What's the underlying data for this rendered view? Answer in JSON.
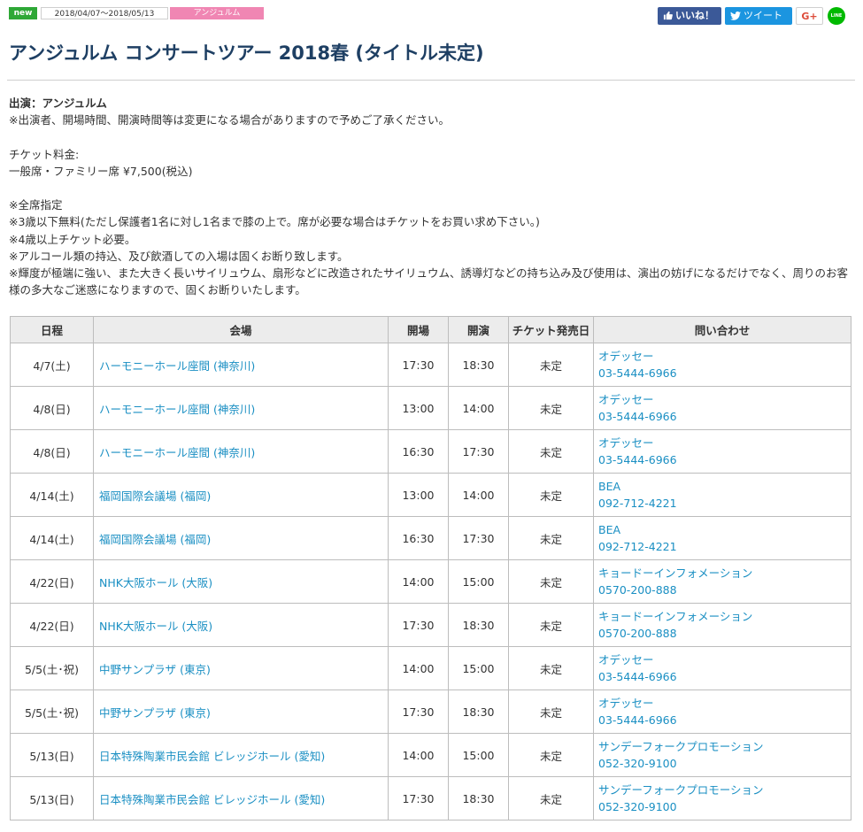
{
  "header": {
    "new_badge": "new",
    "date_range": "2018/04/07〜2018/05/13",
    "artist_tag": "アンジュルム",
    "share": {
      "facebook": "いいね！",
      "twitter": "ツイート",
      "google": "G+",
      "line": "LINE"
    }
  },
  "title": "アンジュルム コンサートツアー 2018春 (タイトル未定)",
  "info": {
    "performer": "出演：アンジュルム",
    "notice": "※出演者、開場時間、開演時間等は変更になる場合がありますので予めご了承ください。",
    "price_label": "チケット料金:",
    "price": "一般席・ファミリー席 ¥7,500(税込)",
    "notes": [
      "※全席指定",
      "※3歳以下無料(ただし保護者1名に対し1名まで膝の上で。席が必要な場合はチケットをお買い求め下さい。)",
      "※4歳以上チケット必要。",
      "※アルコール類の持込、及び飲酒しての入場は固くお断り致します。",
      "※輝度が極端に強い、また大きく長いサイリュウム、扇形などに改造されたサイリュウム、誘導灯などの持ち込み及び使用は、演出の妨げになるだけでなく、周りのお客様の多大なご迷惑になりますので、固くお断りいたします。"
    ]
  },
  "table": {
    "headers": [
      "日程",
      "会場",
      "開場",
      "開演",
      "チケット発売日",
      "問い合わせ"
    ],
    "rows": [
      {
        "date": "4/7(土)",
        "venue": "ハーモニーホール座間 (神奈川)",
        "open": "17:30",
        "start": "18:30",
        "sale": "未定",
        "contact_name": "オデッセー",
        "contact_phone": "03-5444-6966"
      },
      {
        "date": "4/8(日)",
        "venue": "ハーモニーホール座間 (神奈川)",
        "open": "13:00",
        "start": "14:00",
        "sale": "未定",
        "contact_name": "オデッセー",
        "contact_phone": "03-5444-6966"
      },
      {
        "date": "4/8(日)",
        "venue": "ハーモニーホール座間 (神奈川)",
        "open": "16:30",
        "start": "17:30",
        "sale": "未定",
        "contact_name": "オデッセー",
        "contact_phone": "03-5444-6966"
      },
      {
        "date": "4/14(土)",
        "venue": "福岡国際会議場 (福岡)",
        "open": "13:00",
        "start": "14:00",
        "sale": "未定",
        "contact_name": "BEA",
        "contact_phone": "092-712-4221"
      },
      {
        "date": "4/14(土)",
        "venue": "福岡国際会議場 (福岡)",
        "open": "16:30",
        "start": "17:30",
        "sale": "未定",
        "contact_name": "BEA",
        "contact_phone": "092-712-4221"
      },
      {
        "date": "4/22(日)",
        "venue": "NHK大阪ホール (大阪)",
        "open": "14:00",
        "start": "15:00",
        "sale": "未定",
        "contact_name": "キョードーインフォメーション",
        "contact_phone": "0570-200-888"
      },
      {
        "date": "4/22(日)",
        "venue": "NHK大阪ホール (大阪)",
        "open": "17:30",
        "start": "18:30",
        "sale": "未定",
        "contact_name": "キョードーインフォメーション",
        "contact_phone": "0570-200-888"
      },
      {
        "date": "5/5(土･祝)",
        "venue": "中野サンプラザ (東京)",
        "open": "14:00",
        "start": "15:00",
        "sale": "未定",
        "contact_name": "オデッセー",
        "contact_phone": "03-5444-6966"
      },
      {
        "date": "5/5(土･祝)",
        "venue": "中野サンプラザ (東京)",
        "open": "17:30",
        "start": "18:30",
        "sale": "未定",
        "contact_name": "オデッセー",
        "contact_phone": "03-5444-6966"
      },
      {
        "date": "5/13(日)",
        "venue": "日本特殊陶業市民会館 ビレッジホール (愛知)",
        "open": "14:00",
        "start": "15:00",
        "sale": "未定",
        "contact_name": "サンデーフォークプロモーション",
        "contact_phone": "052-320-9100"
      },
      {
        "date": "5/13(日)",
        "venue": "日本特殊陶業市民会館 ビレッジホール (愛知)",
        "open": "17:30",
        "start": "18:30",
        "sale": "未定",
        "contact_name": "サンデーフォークプロモーション",
        "contact_phone": "052-320-9100"
      }
    ]
  },
  "colors": {
    "title": "#1e3f63",
    "link": "#1a8fc3",
    "new_badge": "#2ea836",
    "artist_tag": "#f086b3",
    "facebook": "#3b5998",
    "twitter": "#1b95e0",
    "line": "#00b900"
  }
}
